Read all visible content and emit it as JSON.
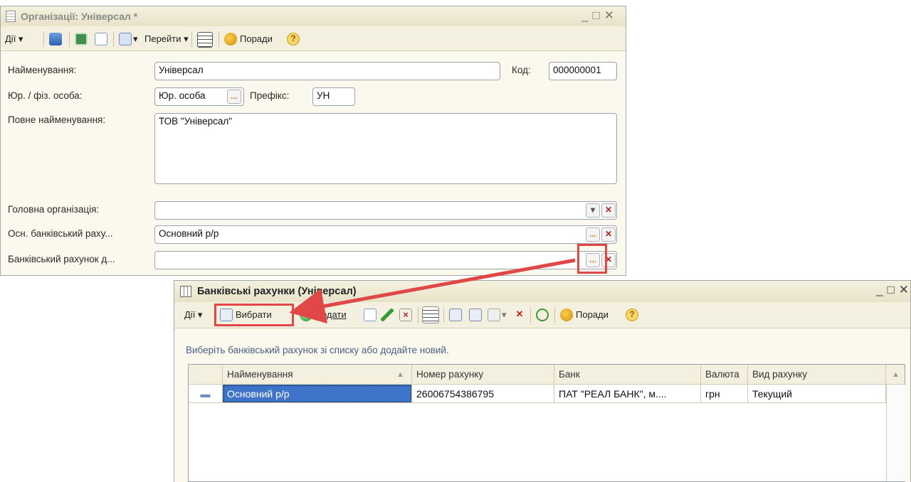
{
  "org_window": {
    "title": "Організації: Універсал *",
    "toolbar": {
      "actions_label": "Дії",
      "goto_label": "Перейти",
      "tips_label": "Поради"
    },
    "fields": {
      "name_label": "Найменування:",
      "name_value": "Універсал",
      "code_label": "Код:",
      "code_value": "000000001",
      "person_label": "Юр. / фіз. особа:",
      "person_value": "Юр. особа",
      "prefix_label": "Префікс:",
      "prefix_value": "УН",
      "fullname_label": "Повне найменування:",
      "fullname_value": "ТОВ \"Універсал\"",
      "head_org_label": "Головна організація:",
      "head_org_value": "",
      "main_bank_label": "Осн. банківський раху...",
      "main_bank_value": "Основний р/р",
      "bank_account_label": "Банківський рахунок д...",
      "bank_account_value": ""
    }
  },
  "bank_window": {
    "title": "Банківські рахунки (Універсал)",
    "toolbar": {
      "actions_label": "Дії",
      "select_label": "Вибрати",
      "add_label": "Додати",
      "tips_label": "Поради"
    },
    "hint": "Виберіть банківський рахунок зі списку або додайте новий.",
    "table": {
      "columns": [
        "Найменування",
        "Номер рахунку",
        "Банк",
        "Валюта",
        "Вид рахунку"
      ],
      "rows": [
        [
          "Основний р/р",
          "26006754386795",
          "ПАТ \"РЕАЛ БАНК\", м....",
          "грн",
          "Текущий"
        ]
      ]
    }
  },
  "colors": {
    "highlight": "#e04848",
    "selection": "#3d74c9",
    "window_bg": "#fbf9ed"
  }
}
